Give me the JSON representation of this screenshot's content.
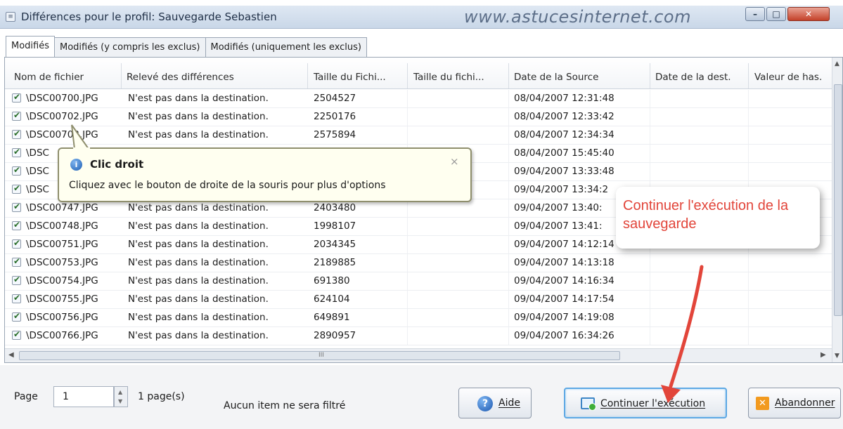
{
  "window": {
    "title": "Différences pour le profil: Sauvegarde Sebastien",
    "watermark": "www.astucesinternet.com",
    "minimize_glyph": "–",
    "maximize_glyph": "□",
    "close_glyph": "✕",
    "system_icon": "menu-icon"
  },
  "tabs": [
    {
      "label": "Modifiés",
      "active": true
    },
    {
      "label": "Modifiés (y compris les exclus)",
      "active": false
    },
    {
      "label": "Modifiés (uniquement les exclus)",
      "active": false
    }
  ],
  "table": {
    "columns": [
      "Nom de fichier",
      "Relevé des différences",
      "Taille du Fichi...",
      "Taille du fichi...",
      "Date de la Source",
      "Date de la dest.",
      "Valeur de has."
    ],
    "rows": [
      {
        "checked": true,
        "name": "\\DSC00700.JPG",
        "diff": "N'est pas dans la destination.",
        "size": "2504527",
        "date": "08/04/2007 12:31:48"
      },
      {
        "checked": true,
        "name": "\\DSC00702.JPG",
        "diff": "N'est pas dans la destination.",
        "size": "2250176",
        "date": "08/04/2007 12:33:42"
      },
      {
        "checked": true,
        "name": "\\DSC00703.JPG",
        "diff": "N'est pas dans la destination.",
        "size": "2575894",
        "date": "08/04/2007 12:34:34"
      },
      {
        "checked": true,
        "name": "\\DSC",
        "diff": "",
        "size": "",
        "date": "08/04/2007 15:45:40"
      },
      {
        "checked": true,
        "name": "\\DSC",
        "diff": "",
        "size": "",
        "date": "09/04/2007 13:33:48"
      },
      {
        "checked": true,
        "name": "\\DSC",
        "diff": "",
        "size": "",
        "date": "09/04/2007 13:34:2"
      },
      {
        "checked": true,
        "name": "\\DSC00747.JPG",
        "diff": "N'est pas dans la destination.",
        "size": "2403480",
        "date": "09/04/2007 13:40:"
      },
      {
        "checked": true,
        "name": "\\DSC00748.JPG",
        "diff": "N'est pas dans la destination.",
        "size": "1998107",
        "date": "09/04/2007 13:41:"
      },
      {
        "checked": true,
        "name": "\\DSC00751.JPG",
        "diff": "N'est pas dans la destination.",
        "size": "2034345",
        "date": "09/04/2007 14:12:14"
      },
      {
        "checked": true,
        "name": "\\DSC00753.JPG",
        "diff": "N'est pas dans la destination.",
        "size": "2189885",
        "date": "09/04/2007 14:13:18"
      },
      {
        "checked": true,
        "name": "\\DSC00754.JPG",
        "diff": "N'est pas dans la destination.",
        "size": "691380",
        "date": "09/04/2007 14:16:34"
      },
      {
        "checked": true,
        "name": "\\DSC00755.JPG",
        "diff": "N'est pas dans la destination.",
        "size": "624104",
        "date": "09/04/2007 14:17:54"
      },
      {
        "checked": true,
        "name": "\\DSC00756.JPG",
        "diff": "N'est pas dans la destination.",
        "size": "649891",
        "date": "09/04/2007 14:19:08"
      },
      {
        "checked": true,
        "name": "\\DSC00766.JPG",
        "diff": "N'est pas dans la destination.",
        "size": "2890957",
        "date": "09/04/2007 16:34:26"
      }
    ]
  },
  "tooltip": {
    "icon": "info-icon",
    "title": "Clic droit",
    "text": "Cliquez avec le bouton de droite de la souris pour plus d'options",
    "close_glyph": "×"
  },
  "annotation": {
    "text": "Continuer l'exécution de la sauvegarde",
    "color": "#e2453a"
  },
  "footer": {
    "page_label": "Page",
    "page_value": "1",
    "page_count": "1 page(s)",
    "filter_status": "Aucun item ne sera filtré",
    "buttons": {
      "aide": "Aide",
      "continuer": "Continuer l'exécution",
      "abandonner": "Abandonner"
    }
  },
  "scrollbar": {
    "grip": "III"
  }
}
